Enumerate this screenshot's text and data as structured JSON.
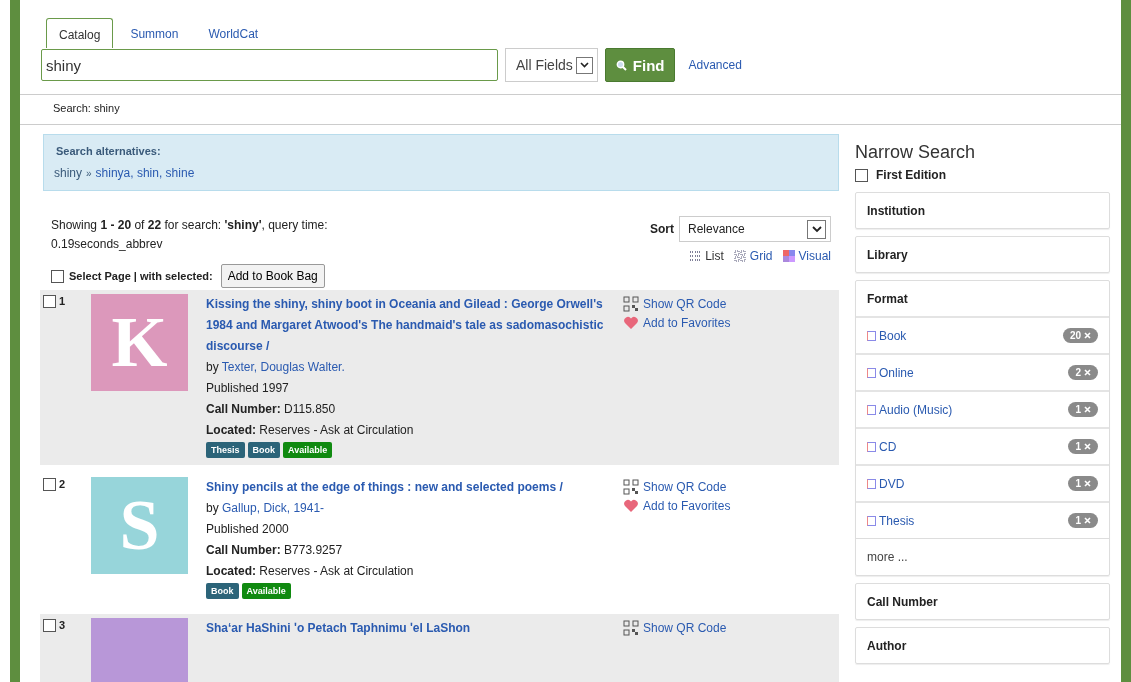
{
  "tabs": [
    {
      "label": "Catalog",
      "selected": true
    },
    {
      "label": "Summon",
      "selected": false
    },
    {
      "label": "WorldCat",
      "selected": false
    }
  ],
  "search": {
    "value": "shiny",
    "field": "All Fields",
    "find_button": "Find",
    "advanced_link": "Advanced"
  },
  "breadcrumb": "Search: shiny",
  "alternatives": {
    "heading": "Search alternatives:",
    "term": "shiny",
    "arrow": "»",
    "suggestions": "shinya, shin, shine"
  },
  "summary": "Showing **1 - 20** of **22** for search: **'shiny'**, query time: 0.19seconds_abbrev",
  "sort": {
    "label": "Sort",
    "value": "Relevance"
  },
  "views": [
    {
      "label": "List",
      "kind": "list"
    },
    {
      "label": "Grid",
      "kind": "grid"
    },
    {
      "label": "Visual",
      "kind": "visual"
    }
  ],
  "select_page": {
    "label": "Select Page | with selected:",
    "checked": false,
    "button": "Add to Book Bag"
  },
  "results": [
    {
      "number": "1",
      "checked": false,
      "cover_letter": "K",
      "color": "#dc98bb",
      "title": "Kissing the shiny, shiny boot in Oceania and Gilead : George Orwell's 1984 and Margaret Atwood's The handmaid's tale as sadomasochistic discourse /",
      "author_prefix": "by",
      "author": "Texter, Douglas Walter.",
      "published": "Published 1997",
      "call_label": "Call Number:",
      "call_number": "D115.850",
      "located_label": "Located:",
      "location": "Reserves - Ask at Circulation",
      "tags": [
        {
          "label": "Thesis",
          "kind": "format"
        },
        {
          "label": "Book",
          "kind": "format"
        },
        {
          "label": "Available",
          "kind": "status"
        }
      ],
      "actions": [
        {
          "label": "Show QR Code",
          "kind": "qr"
        },
        {
          "label": "Add to Favorites",
          "kind": "favorite"
        }
      ]
    },
    {
      "number": "2",
      "checked": false,
      "cover_letter": "S",
      "color": "#97d5da",
      "title": "Shiny pencils at the edge of things : new and selected poems /",
      "author_prefix": "by",
      "author": "Gallup, Dick, 1941-",
      "published": "Published 2000",
      "call_label": "Call Number:",
      "call_number": "B773.9257",
      "located_label": "Located:",
      "location": "Reserves - Ask at Circulation",
      "tags": [
        {
          "label": "Book",
          "kind": "format"
        },
        {
          "label": "Available",
          "kind": "status"
        }
      ],
      "actions": [
        {
          "label": "Show QR Code",
          "kind": "qr"
        },
        {
          "label": "Add to Favorites",
          "kind": "favorite"
        }
      ]
    },
    {
      "number": "3",
      "checked": false,
      "color": "#b897d8",
      "title": "Sha‘ar HaShini ʹo Petach Taphnimu ʹel LaShon",
      "actions": [
        {
          "label": "Show QR Code",
          "kind": "qr"
        }
      ]
    }
  ],
  "sidebar": {
    "title": "Narrow Search",
    "first_edition": {
      "label": "First Edition",
      "checked": false
    },
    "facets": [
      {
        "label": "Institution"
      },
      {
        "label": "Library"
      },
      {
        "label": "Format",
        "items": [
          {
            "label": "Book",
            "count": "20"
          },
          {
            "label": "Online",
            "count": "2"
          },
          {
            "label": "Audio (Music)",
            "count": "1"
          },
          {
            "label": "CD",
            "count": "1"
          },
          {
            "label": "DVD",
            "count": "1"
          },
          {
            "label": "Thesis",
            "count": "1"
          }
        ],
        "more": "more ..."
      },
      {
        "label": "Call Number"
      },
      {
        "label": "Author"
      }
    ]
  }
}
